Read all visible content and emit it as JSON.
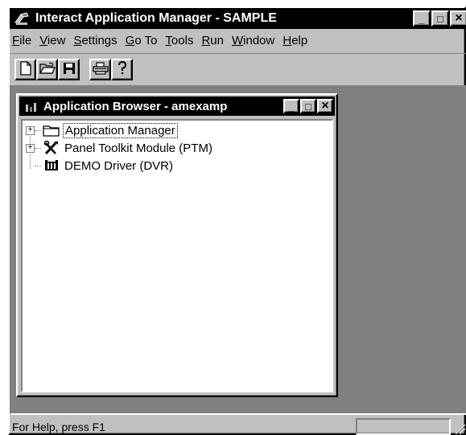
{
  "app": {
    "title": "Interact Application Manager - SAMPLE"
  },
  "title_buttons": [
    {
      "name": "minimize",
      "glyph": "_"
    },
    {
      "name": "maximize",
      "glyph": "□"
    },
    {
      "name": "close",
      "glyph": "×"
    }
  ],
  "menu": [
    {
      "prefix": "",
      "accel": "F",
      "suffix": "ile",
      "name": "file"
    },
    {
      "prefix": "",
      "accel": "V",
      "suffix": "iew",
      "name": "view"
    },
    {
      "prefix": "",
      "accel": "S",
      "suffix": "ettings",
      "name": "settings"
    },
    {
      "prefix": "",
      "accel": "G",
      "suffix": "o To",
      "name": "go-to"
    },
    {
      "prefix": "",
      "accel": "T",
      "suffix": "ools",
      "name": "tools"
    },
    {
      "prefix": "",
      "accel": "R",
      "suffix": "un",
      "name": "run"
    },
    {
      "prefix": "",
      "accel": "W",
      "suffix": "indow",
      "name": "window"
    },
    {
      "prefix": "",
      "accel": "H",
      "suffix": "elp",
      "name": "help"
    }
  ],
  "toolbar": {
    "icons": [
      "new-file-icon",
      "open-folder-icon",
      "save-disk-icon",
      "print-icon",
      "help-question-icon"
    ]
  },
  "child_window": {
    "title": "Application Browser - amexamp"
  },
  "tree": {
    "items": [
      {
        "label": "Application Manager",
        "expander": "+",
        "icon": "folder-icon",
        "selected": true
      },
      {
        "label": "Panel Toolkit Module (PTM)",
        "expander": "+",
        "icon": "tools-icon",
        "selected": false
      },
      {
        "label": "DEMO Driver (DVR)",
        "expander": "",
        "icon": "driver-icon",
        "selected": false
      }
    ]
  },
  "status": {
    "text": "For Help, press F1"
  }
}
